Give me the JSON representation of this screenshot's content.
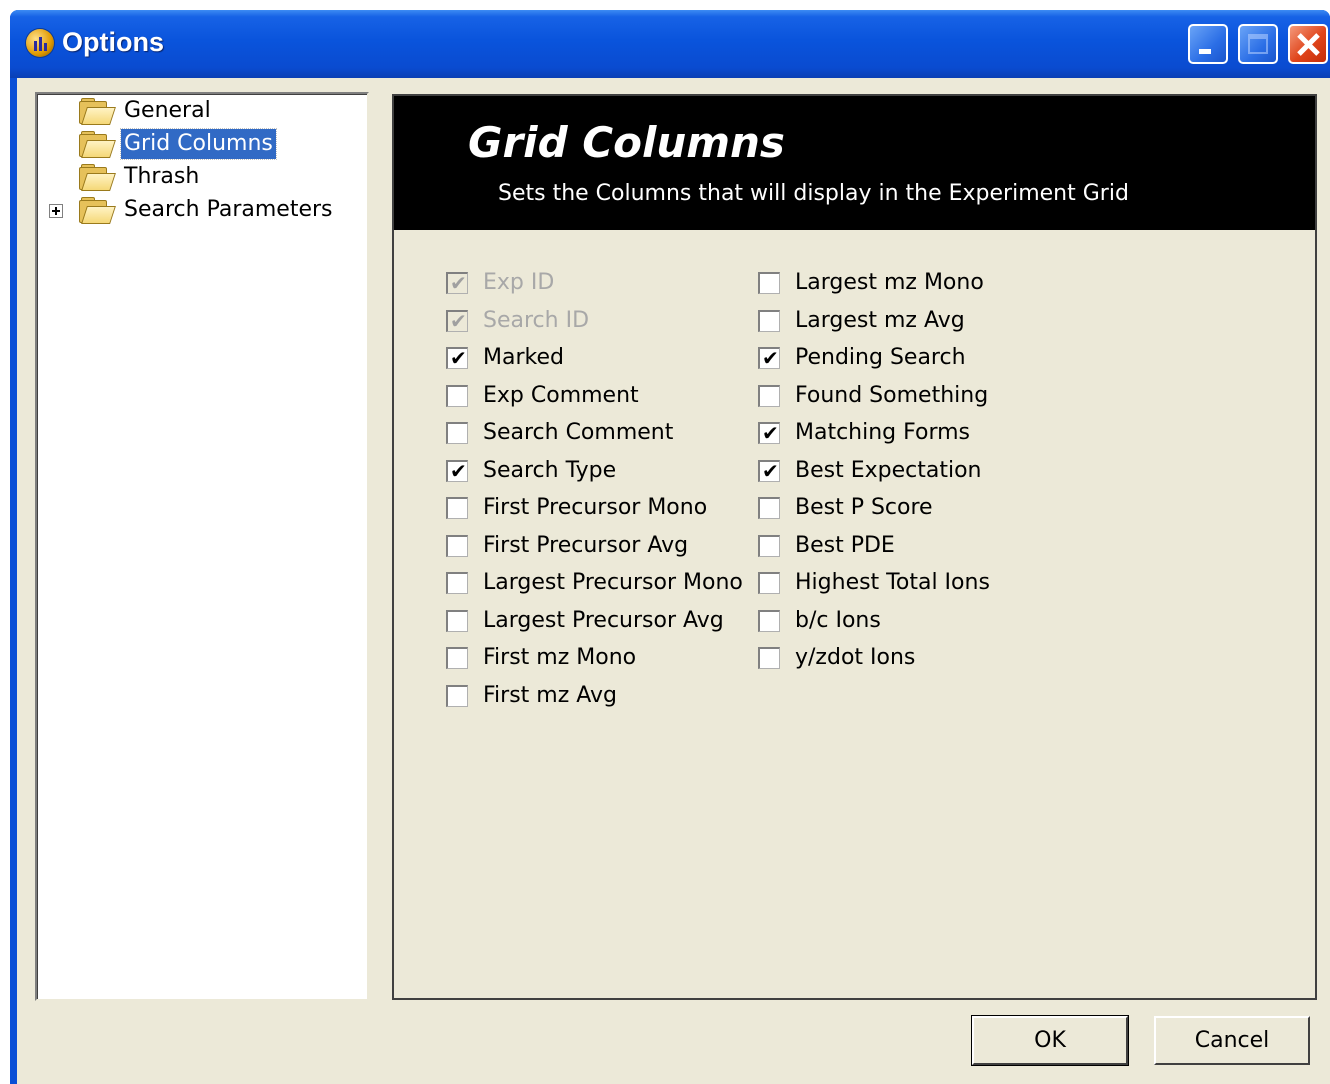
{
  "window": {
    "title": "Options"
  },
  "tree": {
    "items": [
      {
        "label": "General"
      },
      {
        "label": "Grid Columns"
      },
      {
        "label": "Thrash"
      },
      {
        "label": "Search Parameters"
      }
    ]
  },
  "panel": {
    "title": "Grid Columns",
    "subtitle": "Sets the Columns that will display in the Experiment Grid"
  },
  "columns": {
    "left": [
      {
        "label": "Exp ID",
        "checked": true,
        "disabled": true
      },
      {
        "label": "Search ID",
        "checked": true,
        "disabled": true
      },
      {
        "label": "Marked",
        "checked": true,
        "disabled": false
      },
      {
        "label": "Exp Comment",
        "checked": false,
        "disabled": false
      },
      {
        "label": "Search Comment",
        "checked": false,
        "disabled": false
      },
      {
        "label": "Search Type",
        "checked": true,
        "disabled": false
      },
      {
        "label": "First Precursor Mono",
        "checked": false,
        "disabled": false
      },
      {
        "label": "First Precursor Avg",
        "checked": false,
        "disabled": false
      },
      {
        "label": "Largest Precursor Mono",
        "checked": false,
        "disabled": false
      },
      {
        "label": "Largest Precursor Avg",
        "checked": false,
        "disabled": false
      },
      {
        "label": "First mz Mono",
        "checked": false,
        "disabled": false
      },
      {
        "label": "First mz Avg",
        "checked": false,
        "disabled": false
      }
    ],
    "right": [
      {
        "label": "Largest mz Mono",
        "checked": false,
        "disabled": false
      },
      {
        "label": "Largest mz Avg",
        "checked": false,
        "disabled": false
      },
      {
        "label": "Pending Search",
        "checked": true,
        "disabled": false
      },
      {
        "label": "Found Something",
        "checked": false,
        "disabled": false
      },
      {
        "label": "Matching Forms",
        "checked": true,
        "disabled": false
      },
      {
        "label": "Best Expectation",
        "checked": true,
        "disabled": false
      },
      {
        "label": "Best P Score",
        "checked": false,
        "disabled": false
      },
      {
        "label": "Best PDE",
        "checked": false,
        "disabled": false
      },
      {
        "label": "Highest Total Ions",
        "checked": false,
        "disabled": false
      },
      {
        "label": "b/c Ions",
        "checked": false,
        "disabled": false
      },
      {
        "label": "y/zdot Ions",
        "checked": false,
        "disabled": false
      }
    ]
  },
  "buttons": {
    "ok": "OK",
    "cancel": "Cancel"
  },
  "colors": {
    "title_bar": "#0a54dc",
    "selection": "#316ac5",
    "face": "#ece9d8"
  }
}
